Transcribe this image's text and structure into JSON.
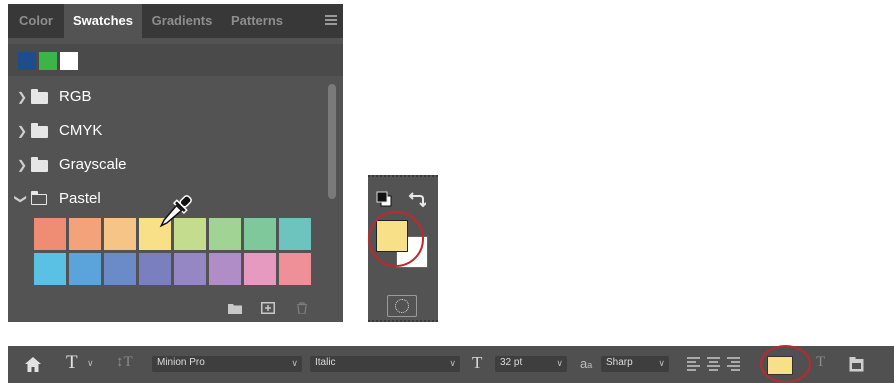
{
  "swatches_panel": {
    "tabs": [
      {
        "label": "Color",
        "active": false
      },
      {
        "label": "Swatches",
        "active": true
      },
      {
        "label": "Gradients",
        "active": false
      },
      {
        "label": "Patterns",
        "active": false
      }
    ],
    "recent_colors": [
      "#1f4d8c",
      "#3bb44a",
      "#ffffff"
    ],
    "groups": [
      {
        "label": "RGB",
        "expanded": false
      },
      {
        "label": "CMYK",
        "expanded": false
      },
      {
        "label": "Grayscale",
        "expanded": false
      },
      {
        "label": "Pastel",
        "expanded": true
      }
    ],
    "pastel_swatches": [
      [
        "#ef8c74",
        "#f4a27a",
        "#f7c488",
        "#f8e088",
        "#c4dc8e",
        "#a0d394",
        "#7ec89c",
        "#6dc4bf"
      ],
      [
        "#5ac1e4",
        "#5aa3db",
        "#6b8ac8",
        "#7a7fc0",
        "#9487c3",
        "#b08dc6",
        "#e79ac0",
        "#ef9098"
      ]
    ],
    "footer_buttons": [
      "new-group-icon",
      "new-swatch-icon",
      "delete-icon"
    ]
  },
  "tools": {
    "foreground_color": "#f8e088",
    "background_color": "#ffffff"
  },
  "options_bar": {
    "font_family": "Minion Pro",
    "font_style": "Italic",
    "font_size": "32 pt",
    "aa_label": "a",
    "aa_sub": "a",
    "antialias": "Sharp",
    "text_color": "#f8e088",
    "highlight_color": "#c1272d"
  }
}
